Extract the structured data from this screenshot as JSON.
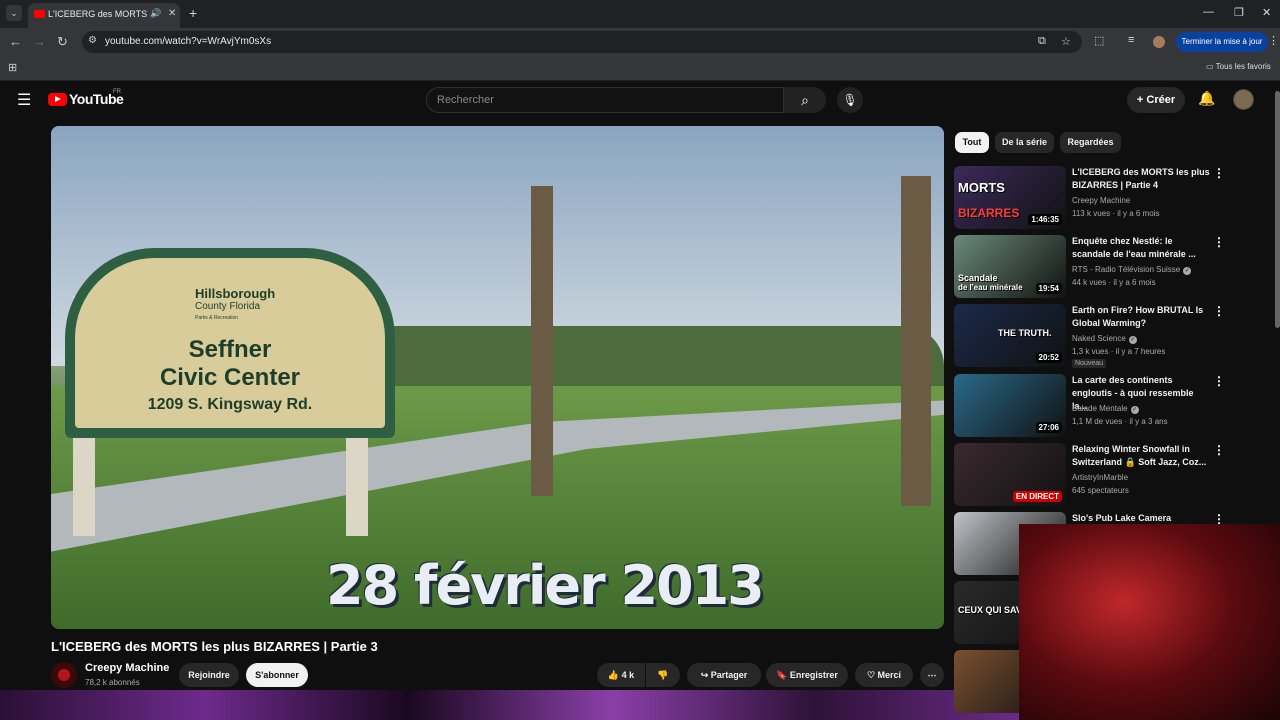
{
  "browser": {
    "tab_title": "L'ICEBERG des MORTS les plus BIZARRES | Partie 3",
    "url": "youtube.com/watch?v=WrAvjYm0sXs",
    "update_label": "Terminer la mise à jour",
    "bookmarks_label": "Tous les favoris"
  },
  "header": {
    "logo_text": "YouTube",
    "country": "FR",
    "search_placeholder": "Rechercher",
    "create_label": "Créer"
  },
  "video": {
    "sign_line1": "Hillsborough",
    "sign_line2": "County Florida",
    "sign_line3": "Parks & Recreation",
    "sign_name1": "Seffner",
    "sign_name2": "Civic Center",
    "sign_address": "1209 S. Kingsway Rd.",
    "caption": "28 février 2013",
    "title": "L'ICEBERG des MORTS les plus BIZARRES | Partie 3",
    "channel": "Creepy Machine",
    "subscribers": "78,2 k abonnés",
    "join_label": "Rejoindre",
    "subscribe_label": "S'abonner",
    "likes": "4 k",
    "share_label": "Partager",
    "save_label": "Enregistrer",
    "thanks_label": "Merci"
  },
  "chips": [
    "Tout",
    "De la série",
    "Regardées"
  ],
  "recommendations": [
    {
      "title": "L'ICEBERG des MORTS les plus BIZARRES | Partie 4",
      "channel": "Creepy Machine",
      "verified": false,
      "meta": "113 k vues · il y a 6 mois",
      "duration": "1:46:35",
      "thumb_text": "MORTS",
      "thumb_text2": "BIZARRES",
      "thumb_color": "#3b2a5a"
    },
    {
      "title": "Enquête chez Nestlé: le scandale de l'eau minérale ...",
      "channel": "RTS - Radio Télévision Suisse",
      "verified": true,
      "meta": "44 k vues · il y a 6 mois",
      "duration": "19:54",
      "thumb_text": "Scandale",
      "thumb_text2": "de l'eau minérale",
      "thumb_color": "#6a8a7a"
    },
    {
      "title": "Earth on Fire? How BRUTAL Is Global Warming?",
      "channel": "Naked Science",
      "verified": true,
      "meta": "1,3 k vues · il y a 7 heures",
      "badge": "Nouveau",
      "duration": "20:52",
      "thumb_text": "THE TRUTH.",
      "thumb_text2": "",
      "thumb_color": "#1a2a4a"
    },
    {
      "title": "La carte des continents engloutis - à quoi ressemble la...",
      "channel": "Balade Mentale",
      "verified": true,
      "meta": "1,1 M de vues · il y a 3 ans",
      "duration": "27:06",
      "thumb_text": "",
      "thumb_text2": "",
      "thumb_color": "#2a6a8a"
    },
    {
      "title": "Relaxing Winter Snowfall in Switzerland 🔒 Soft Jazz, Coz...",
      "channel": "ArtistryInMarble",
      "verified": false,
      "meta": "645 spectateurs",
      "live": "EN DIRECT",
      "thumb_text": "",
      "thumb_text2": "",
      "thumb_color": "#3a2a30"
    },
    {
      "title": "Slo's Pub Lake Camera",
      "channel": "",
      "verified": false,
      "meta": "",
      "thumb_text": "",
      "thumb_text2": "",
      "thumb_color": "#c0c4c8"
    },
    {
      "title": "",
      "channel": "",
      "verified": false,
      "meta": "",
      "thumb_text": "CEUX QUI SAVENT",
      "thumb_text2": "",
      "thumb_color": "#2a2a2a"
    },
    {
      "title": "",
      "channel": "",
      "verified": false,
      "meta": "",
      "thumb_text": "",
      "thumb_text2": "",
      "thumb_color": "#7a5030"
    }
  ]
}
